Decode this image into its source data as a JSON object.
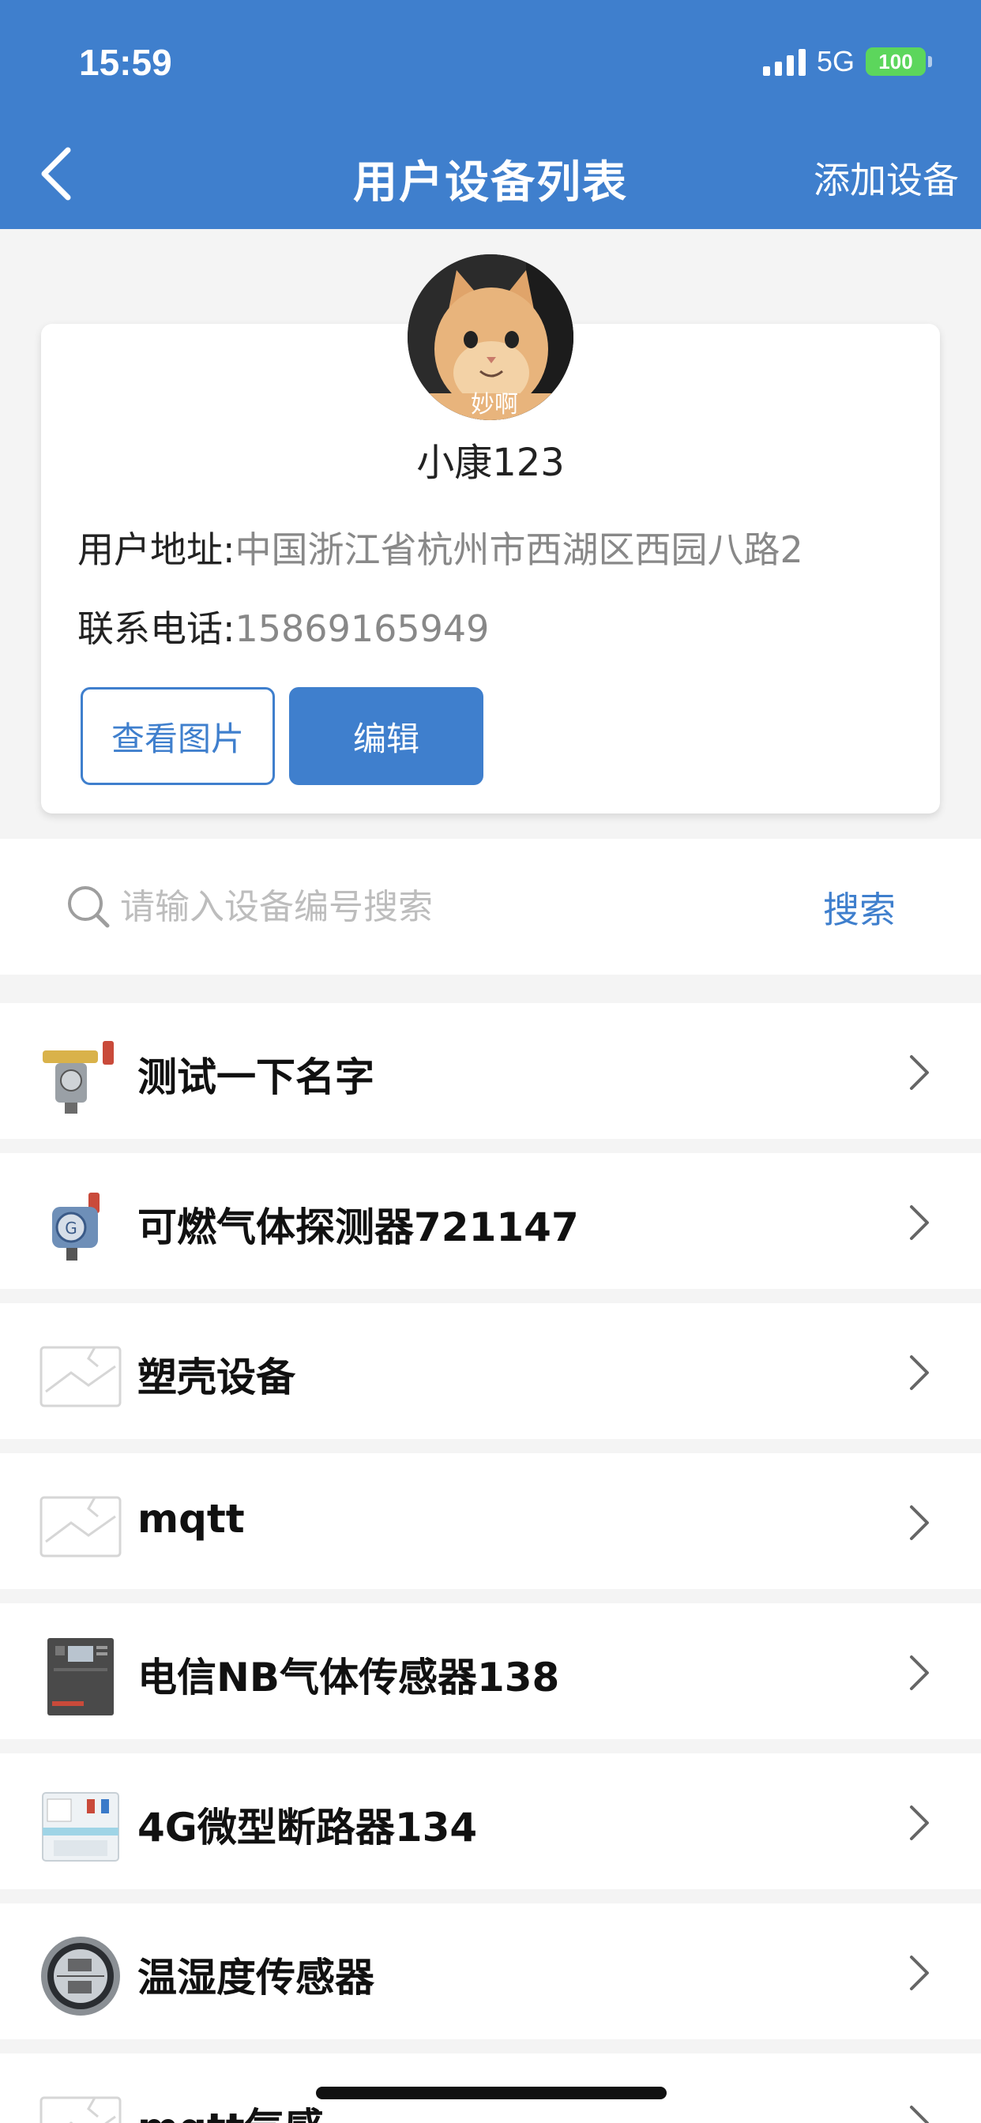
{
  "status_bar": {
    "time": "15:59",
    "network": "5G",
    "battery": "100"
  },
  "nav": {
    "title": "用户设备列表",
    "action": "添加设备"
  },
  "profile": {
    "name": "小康123",
    "address_label": "用户地址:",
    "address": "中国浙江省杭州市西湖区西园八路2",
    "phone_label": "联系电话:",
    "phone": "15869165949",
    "view_photos_label": "查看图片",
    "edit_label": "编辑",
    "avatar_caption": "妙啊"
  },
  "search": {
    "placeholder": "请输入设备编号搜索",
    "button_label": "搜索"
  },
  "devices": [
    {
      "name": "测试一下名字",
      "icon": "gas-detector-icon"
    },
    {
      "name": "可燃气体探测器721147",
      "icon": "gas-detector-icon"
    },
    {
      "name": "塑壳设备",
      "icon": "image-placeholder-icon"
    },
    {
      "name": "mqtt",
      "icon": "image-placeholder-icon"
    },
    {
      "name": "电信NB气体传感器138",
      "icon": "control-panel-icon"
    },
    {
      "name": "4G微型断路器134",
      "icon": "circuit-breaker-icon"
    },
    {
      "name": "温湿度传感器",
      "icon": "thermo-hygrometer-icon"
    },
    {
      "name": "mqtt气感",
      "icon": "image-placeholder-icon"
    }
  ],
  "colors": {
    "brand": "#3f7fcd",
    "background": "#f4f4f4"
  }
}
